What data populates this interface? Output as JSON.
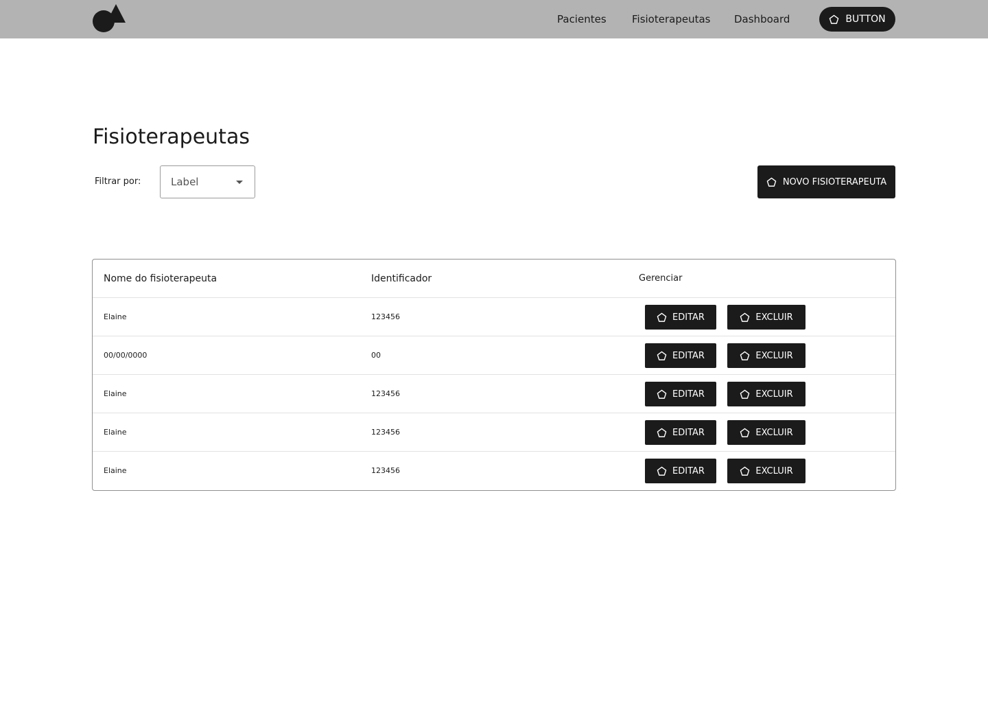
{
  "nav": {
    "links": [
      "Pacientes",
      "Fisioterapeutas",
      "Dashboard"
    ],
    "button_label": "BUTTON",
    "button_icon": "pentagon-icon"
  },
  "page": {
    "title": "Fisioterapeutas"
  },
  "filter": {
    "label": "Filtrar por:",
    "select_value": "Label"
  },
  "new_button": {
    "label": "NOVO FISIOTERAPEUTA",
    "icon": "pentagon-icon"
  },
  "table": {
    "headers": [
      "Nome do fisioterapeuta",
      "Identificador",
      "Gerenciar"
    ],
    "rows": [
      {
        "name": "Elaine",
        "id": "123456"
      },
      {
        "name": "00/00/0000",
        "id": "00"
      },
      {
        "name": "Elaine",
        "id": "123456"
      },
      {
        "name": "Elaine",
        "id": "123456"
      },
      {
        "name": "Elaine",
        "id": "123456"
      }
    ],
    "edit_label": "EDITAR",
    "delete_label": "EXCLUIR"
  },
  "colors": {
    "navbar_bg": "#b3b3b3",
    "button_bg": "#1b1b1b",
    "button_text": "#ffffff"
  }
}
